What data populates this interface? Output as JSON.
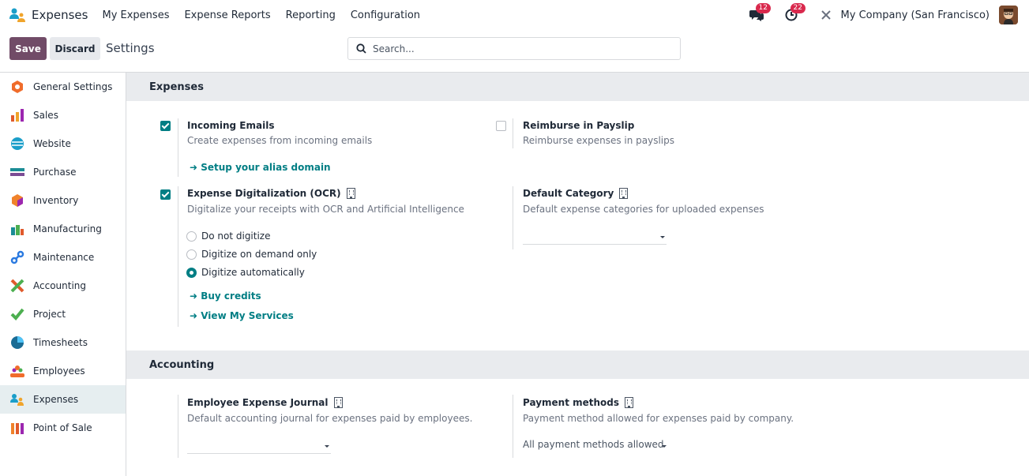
{
  "navbar": {
    "brand": "Expenses",
    "menu": [
      "My Expenses",
      "Expense Reports",
      "Reporting",
      "Configuration"
    ],
    "messages_count": "12",
    "activities_count": "22",
    "company": "My Company (San Francisco)"
  },
  "control": {
    "save_label": "Save",
    "discard_label": "Discard",
    "title": "Settings",
    "search_placeholder": "Search..."
  },
  "sidebar": {
    "items": [
      {
        "label": "General Settings",
        "icon": "general-settings-icon",
        "color": "#f06c2b"
      },
      {
        "label": "Sales",
        "icon": "sales-icon",
        "color": "#f0a42b"
      },
      {
        "label": "Website",
        "icon": "website-icon",
        "color": "#1a9ec9"
      },
      {
        "label": "Purchase",
        "icon": "purchase-icon",
        "color": "#1a8c95"
      },
      {
        "label": "Inventory",
        "icon": "inventory-icon",
        "color": "#f0822b"
      },
      {
        "label": "Manufacturing",
        "icon": "manufacturing-icon",
        "color": "#1a8c95"
      },
      {
        "label": "Maintenance",
        "icon": "maintenance-icon",
        "color": "#2b7ae0"
      },
      {
        "label": "Accounting",
        "icon": "accounting-icon",
        "color": "#e05a2b"
      },
      {
        "label": "Project",
        "icon": "project-icon",
        "color": "#4caf50"
      },
      {
        "label": "Timesheets",
        "icon": "timesheets-icon",
        "color": "#1a6c95"
      },
      {
        "label": "Employees",
        "icon": "employees-icon",
        "color": "#f06c2b"
      },
      {
        "label": "Expenses",
        "icon": "expenses-icon",
        "color": "#1a9ec9",
        "active": true
      },
      {
        "label": "Point of Sale",
        "icon": "point-of-sale-icon",
        "color": "#f0822b"
      }
    ]
  },
  "sections": {
    "expenses": {
      "header": "Expenses",
      "incoming_emails": {
        "title": "Incoming Emails",
        "desc": "Create expenses from incoming emails",
        "link": "Setup your alias domain",
        "checked": true
      },
      "reimburse_payslip": {
        "title": "Reimburse in Payslip",
        "desc": "Reimburse expenses in payslips",
        "checked": false
      },
      "ocr": {
        "title": "Expense Digitalization (OCR)",
        "desc": "Digitalize your receipts with OCR and Artificial Intelligence",
        "checked": true,
        "options": [
          "Do not digitize",
          "Digitize on demand only",
          "Digitize automatically"
        ],
        "selected": "Digitize automatically",
        "link_buy": "Buy credits",
        "link_services": "View My Services"
      },
      "default_category": {
        "title": "Default Category",
        "desc": "Default expense categories for uploaded expenses",
        "value": ""
      }
    },
    "accounting": {
      "header": "Accounting",
      "journal": {
        "title": "Employee Expense Journal",
        "desc": "Default accounting journal for expenses paid by employees.",
        "value": ""
      },
      "payment_methods": {
        "title": "Payment methods",
        "desc": "Payment method allowed for expenses paid by company.",
        "value": "All payment methods allowed"
      }
    }
  },
  "colors": {
    "brand": "#714b67",
    "accent": "#017e84",
    "badge": "#d9294d"
  }
}
